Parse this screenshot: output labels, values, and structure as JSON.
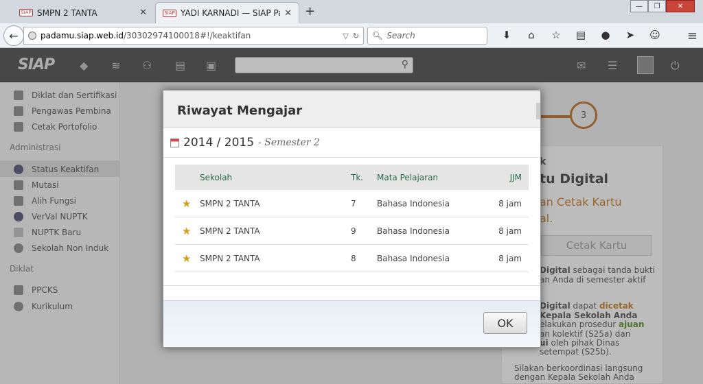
{
  "browser": {
    "tabs": [
      {
        "label": "SMPN 2 TANTA",
        "favicon": "SIAP"
      },
      {
        "label": "YADI KARNADI — SIAP Pa...",
        "favicon": "SIAP"
      }
    ],
    "url_domain": "padamu.siap.web.id",
    "url_path": "/30302974100018#!/keaktifan",
    "search_placeholder": "Search"
  },
  "app": {
    "logo": "SIAP",
    "sidebar": {
      "top_items": [
        "Diklat dan Sertifikasi",
        "Pengawas Pembina",
        "Cetak Portofolio"
      ],
      "admin_heading": "Administrasi",
      "admin_items": [
        "Status Keaktifan",
        "Mutasi",
        "Alih Fungsi",
        "VerVal NUPTK",
        "NUPTK Baru",
        "Sekolah Non Induk"
      ],
      "diklat_heading": "Diklat",
      "diklat_items": [
        "PPCKS",
        "Kurikulum"
      ]
    },
    "right_panel": {
      "step_number": "3",
      "heading_partial": "tu Digital",
      "subheading_partial": "an Cetak Kartu",
      "subheading_partial2": "al.",
      "button": "Cetak Kartu",
      "text1_bold": "Digital",
      "text1_rest": " sebagai tanda bukti",
      "text2": "an Anda di semester aktif",
      "text3_bold": "Digital",
      "text3_mid": " dapat ",
      "text3_highlight": "dicetak",
      "text4": "Kepala Sekolah Anda",
      "text5": "elakukan prosedur ",
      "text5_highlight": "ajuan",
      "text6": "an kolektif (S25a) dan",
      "text7_bold": "ui",
      "text7_rest": " oleh pihak Dinas",
      "text8": "setempat (S25b).",
      "text9": "Silakan berkoordinasi langsung",
      "text10": "dengan Kepala Sekolah Anda"
    }
  },
  "modal": {
    "title": "Riwayat Mengajar",
    "year": "2014 / 2015",
    "semester": "- Semester 2",
    "columns": {
      "school": "Sekolah",
      "grade": "Tk.",
      "subject": "Mata Pelajaran",
      "hours": "JJM"
    },
    "rows": [
      {
        "school": "SMPN 2 TANTA",
        "grade": "7",
        "subject": "Bahasa Indonesia",
        "hours": "8 jam"
      },
      {
        "school": "SMPN 2 TANTA",
        "grade": "9",
        "subject": "Bahasa Indonesia",
        "hours": "8 jam"
      },
      {
        "school": "SMPN 2 TANTA",
        "grade": "8",
        "subject": "Bahasa Indonesia",
        "hours": "8 jam"
      }
    ],
    "ok_label": "OK"
  }
}
